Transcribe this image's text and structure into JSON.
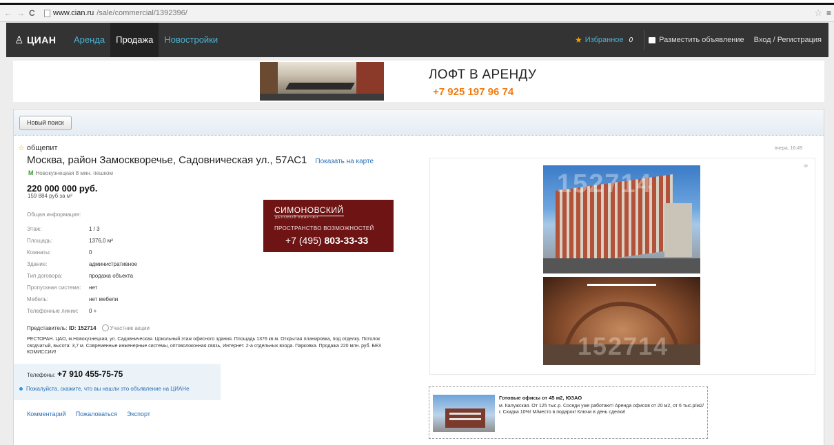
{
  "browser": {
    "url_host": "www.cian.ru",
    "url_path": "/sale/commercial/1392396/"
  },
  "header": {
    "logo_text": "ЦИАН",
    "nav": [
      "Аренда",
      "Продажа",
      "Новостройки"
    ],
    "favorites_label": "Избранное",
    "favorites_count": "0",
    "post_ad_label": "Разместить объявление",
    "login_label": "Вход / Регистрация",
    "colors": {
      "accent": "#4bb3d4",
      "header_bg": "#333333",
      "star": "#f0a500"
    }
  },
  "banner": {
    "title": "ЛОФТ В АРЕНДУ",
    "phone": "+7 925 197 96 74"
  },
  "toolbar": {
    "new_search_label": "Новый поиск"
  },
  "listing": {
    "type": "общепит",
    "date": "вчера, 16:49",
    "address": "Москва, район Замоскворечье, Садовническая ул., 57АС1",
    "map_link": "Показать на карте",
    "metro": "Новокузнецкая 8 мин. пешком",
    "price": "220 000 000 руб.",
    "price_per_m2": "159 884 руб за м²",
    "info_head": "Общая информация:",
    "info": [
      {
        "label": "Этаж:",
        "value": "1 / 3"
      },
      {
        "label": "Площадь:",
        "value": "1376,0 м²"
      },
      {
        "label": "Комнаты:",
        "value": "0"
      },
      {
        "label": "Здание:",
        "value": "административное"
      },
      {
        "label": "Тип договора:",
        "value": "продажа объекта"
      },
      {
        "label": "Пропускная система:",
        "value": "нет"
      },
      {
        "label": "Мебель:",
        "value": "нет мебели"
      },
      {
        "label": "Телефонные линии:",
        "value": "0 +"
      }
    ],
    "representative_label": "Представитель:",
    "representative_id": "ID: 152714",
    "participant_label": "Участник акции",
    "description": "РЕСТОРАН. ЦАО, м.Новокузнецкая, ул. Садовническая. Цокольный этаж офисного здания. Площадь 1376 кв.м. Открытая планировка, под отделку. Потолок сводчатый, высота: 3,7 м. Современные инженерные системы, оптоволоконная связь, Интернет. 2-а отдельных входа. Парковка. Продажа 220 млн. руб. БЕЗ КОМИССИИ!",
    "phones_label": "Телефоны:",
    "phone": "+7 910 455-75-75",
    "please_text": "Пожалуйста, скажите, что вы нашли это объявление на ЦИАНе",
    "actions": [
      "Комментарий",
      "Пожаловаться",
      "Экспорт"
    ]
  },
  "sim_ad": {
    "brand": "СИМОНОВСКИЙ",
    "brand_sub": "ДЕЛОВОЙ КВАРТАЛ",
    "slogan": "ПРОСТРАНСТВО ВОЗМОЖНОСТЕЙ",
    "phone_prefix": "+7 (495) ",
    "phone_main": "803-33-33"
  },
  "photos": {
    "watermark1": "152714",
    "watermark2": "152714"
  },
  "offer": {
    "title": "Готовые офисы от 45 м2, ЮЗАО",
    "text": "м. Калужская. От 125 тыс.р. Соседи уже работают! Аренда офисов от 20 м2, от 6 тыс.р/м2/г. Скидка 10%! М/место в подарок! Ключи в день сделки!"
  }
}
